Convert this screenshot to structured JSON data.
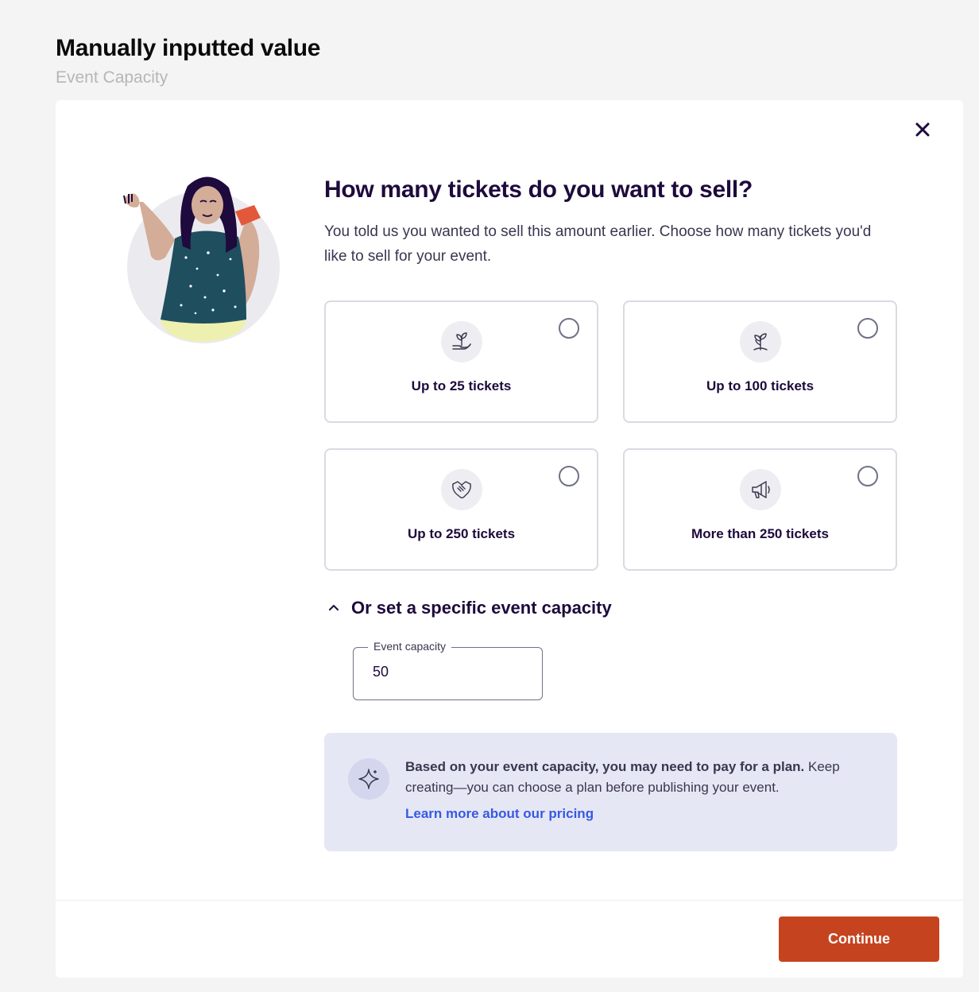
{
  "page": {
    "heading": "Manually inputted value",
    "subheading": "Event Capacity"
  },
  "modal": {
    "close_icon": "close-icon",
    "title": "How many tickets do you want to sell?",
    "description": "You told us you wanted to sell this amount earlier. Choose how many tickets you'd like to sell for your event.",
    "options": [
      {
        "label": "Up to 25 tickets",
        "icon": "sprout-in-hand-icon",
        "selected": false
      },
      {
        "label": "Up to 100 tickets",
        "icon": "plant-icon",
        "selected": false
      },
      {
        "label": "Up to 250 tickets",
        "icon": "handshake-icon",
        "selected": false
      },
      {
        "label": "More than 250 tickets",
        "icon": "megaphone-icon",
        "selected": false
      }
    ],
    "capacity_section": {
      "toggle_label": "Or set a specific event capacity",
      "toggle_icon": "chevron-up-icon",
      "field_label": "Event capacity",
      "field_value": "50"
    },
    "info": {
      "icon": "sparkle-icon",
      "bold_text": "Based on your event capacity, you may need to pay for a plan.",
      "text": " Keep creating—you can choose a plan before publishing your event.",
      "link": "Learn more about our pricing"
    },
    "continue_label": "Continue"
  },
  "colors": {
    "accent": "#c5441f",
    "link": "#3659e3",
    "info_bg": "#e6e7f4",
    "heading": "#1e0a3c"
  }
}
